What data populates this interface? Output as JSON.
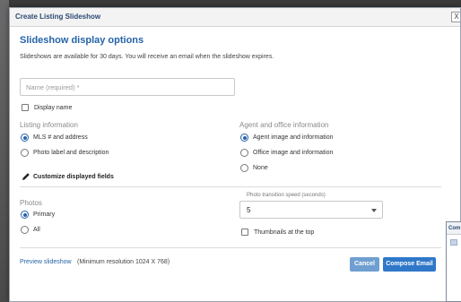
{
  "dialog": {
    "title": "Create Listing Slideshow",
    "close_label": "X",
    "heading": "Slideshow display options",
    "description": "Slideshows are available for 30 days. You will receive an email when the slideshow expires."
  },
  "name_field": {
    "placeholder": "Name (required) *",
    "value": ""
  },
  "display_name": {
    "label": "Display name",
    "checked": false
  },
  "listing_information": {
    "label": "Listing information",
    "options": [
      {
        "label": "MLS # and address",
        "selected": true
      },
      {
        "label": "Photo label and description",
        "selected": false
      }
    ]
  },
  "agent_office_information": {
    "label": "Agent and office information",
    "options": [
      {
        "label": "Agent image and information",
        "selected": true
      },
      {
        "label": "Office image and information",
        "selected": false
      },
      {
        "label": "None",
        "selected": false
      }
    ]
  },
  "customize": {
    "label": "Customize displayed fields",
    "icon": "pencil-icon"
  },
  "photos": {
    "label": "Photos",
    "options": [
      {
        "label": "Primary",
        "selected": true
      },
      {
        "label": "All",
        "selected": false
      }
    ]
  },
  "transition_speed": {
    "label": "Photo transition speed (seconds)",
    "value": "5"
  },
  "thumbnails": {
    "label": "Thumbnails at the top",
    "checked": false
  },
  "footer": {
    "preview_link": "Preview slideshow",
    "min_resolution": "(Minimum resolution 1024 X 768)",
    "cancel_label": "Cancel",
    "compose_label": "Compose Email"
  },
  "background_window": {
    "title_fragment": "Com"
  },
  "colors": {
    "accent": "#2563a8",
    "primary_button": "#2f78c9",
    "secondary_button": "#6f9fd0"
  }
}
